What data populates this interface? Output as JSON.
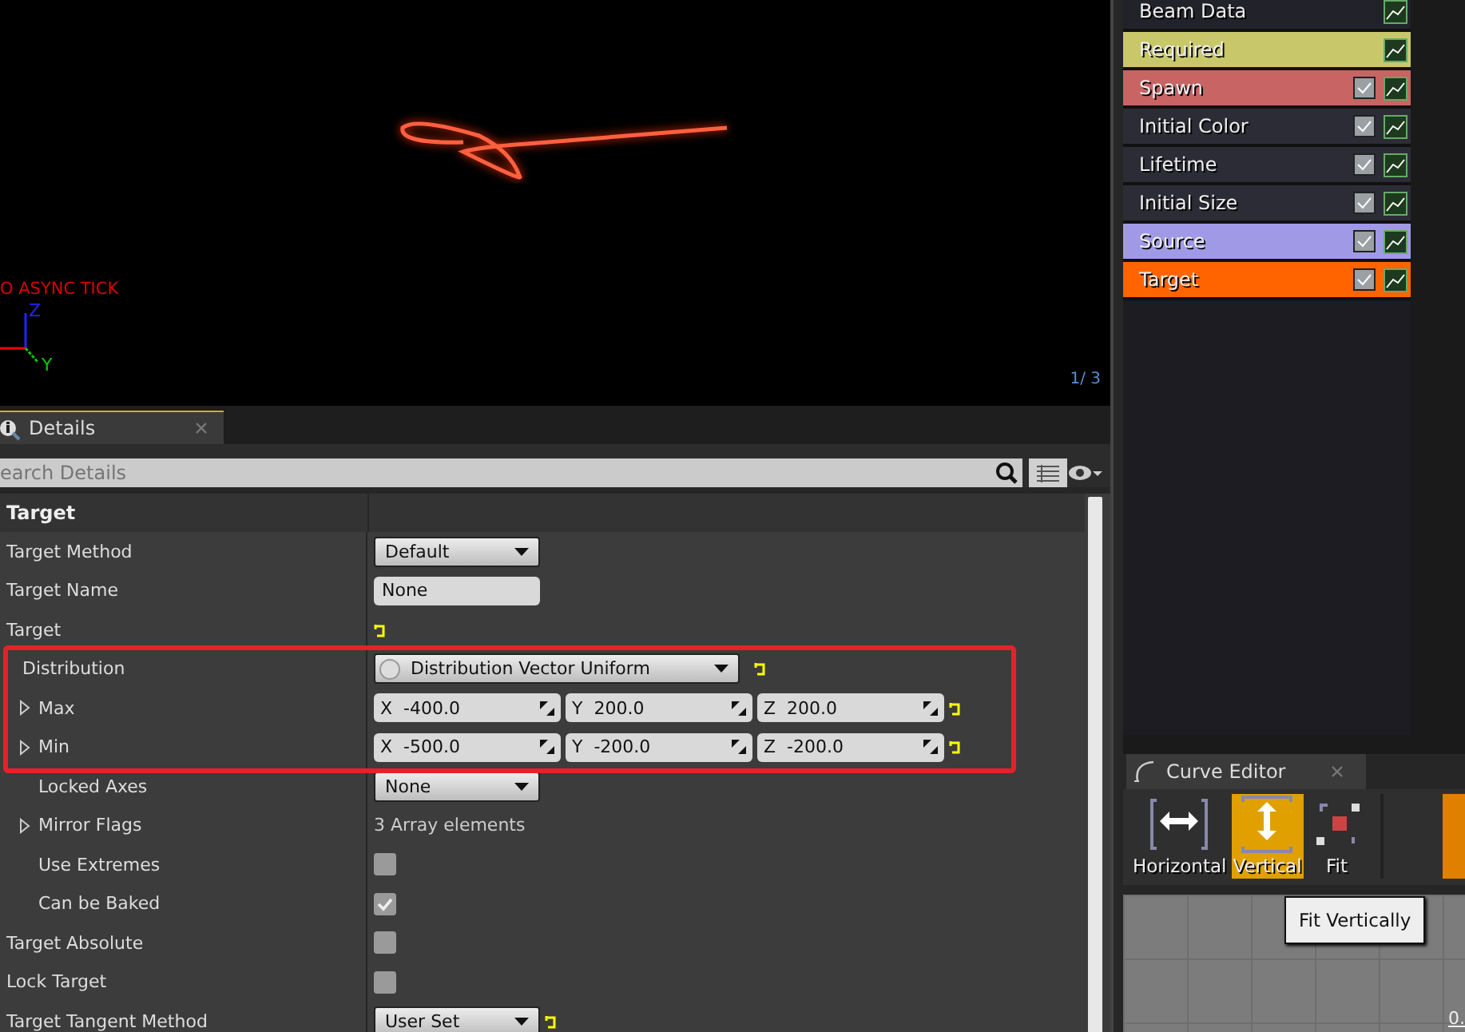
{
  "viewport": {
    "status_text": "O ASYNC TICK",
    "axis_labels": [
      "Z",
      "Y"
    ],
    "frame_counter": "1/ 3"
  },
  "modules": [
    {
      "label": "Beam Data",
      "color": "#22222a"
    },
    {
      "label": "Required",
      "color": "#c8c86a"
    },
    {
      "label": "Spawn",
      "color": "#c86464",
      "checked": true
    },
    {
      "label": "Initial Color",
      "color": "#2c2c36",
      "checked": true
    },
    {
      "label": "Lifetime",
      "color": "#2c2c36",
      "checked": true
    },
    {
      "label": "Initial Size",
      "color": "#2c2c36",
      "checked": true
    },
    {
      "label": "Source",
      "color": "#a09ae6",
      "checked": true
    },
    {
      "label": "Target",
      "color": "#ff6400",
      "checked": true
    }
  ],
  "details": {
    "tab": "Details",
    "search": {
      "placeholder": "earch Details"
    },
    "category": "Target",
    "properties": [
      {
        "label": "Target Method",
        "kind": "dropdown",
        "value": "Default"
      },
      {
        "label": "Target Name",
        "kind": "text",
        "value": "None"
      },
      {
        "label": "Target",
        "kind": "reset",
        "children": [
          {
            "label": "Distribution",
            "kind": "distribution",
            "value": "Distribution Vector Uniform",
            "expanded": true,
            "highlighted": true,
            "children": [
              {
                "label": "Max",
                "kind": "vector",
                "expanded": false,
                "highlighted": true,
                "components": [
                  {
                    "axis": "X",
                    "value": "-400.0"
                  },
                  {
                    "axis": "Y",
                    "value": "200.0"
                  },
                  {
                    "axis": "Z",
                    "value": "200.0"
                  }
                ]
              },
              {
                "label": "Min",
                "kind": "vector",
                "expanded": false,
                "highlighted": true,
                "components": [
                  {
                    "axis": "X",
                    "value": "-500.0"
                  },
                  {
                    "axis": "Y",
                    "value": "-200.0"
                  },
                  {
                    "axis": "Z",
                    "value": "-200.0"
                  }
                ]
              },
              {
                "label": "Locked Axes",
                "kind": "dropdown",
                "value": "None"
              },
              {
                "label": "Mirror Flags",
                "kind": "note",
                "value": "3 Array elements",
                "expanded": false
              },
              {
                "label": "Use Extremes",
                "kind": "checkbox",
                "checked": false
              },
              {
                "label": "Can be Baked",
                "kind": "checkbox",
                "checked": true
              }
            ]
          }
        ]
      },
      {
        "label": "Target Absolute",
        "kind": "checkbox",
        "checked": false
      },
      {
        "label": "Lock Target",
        "kind": "checkbox",
        "checked": false
      },
      {
        "label": "Target Tangent Method",
        "kind": "dropdown-reset",
        "value": "User Set"
      }
    ]
  },
  "curve_editor": {
    "tab": "Curve Editor",
    "tools": [
      {
        "label": "Horizontal",
        "kind": "horizontal",
        "selected": false
      },
      {
        "label": "Vertical",
        "kind": "vertical",
        "selected": true
      },
      {
        "label": "Fit",
        "kind": "fit",
        "selected": false
      }
    ],
    "tooltip": "Fit Vertically",
    "axis_value": "0."
  }
}
